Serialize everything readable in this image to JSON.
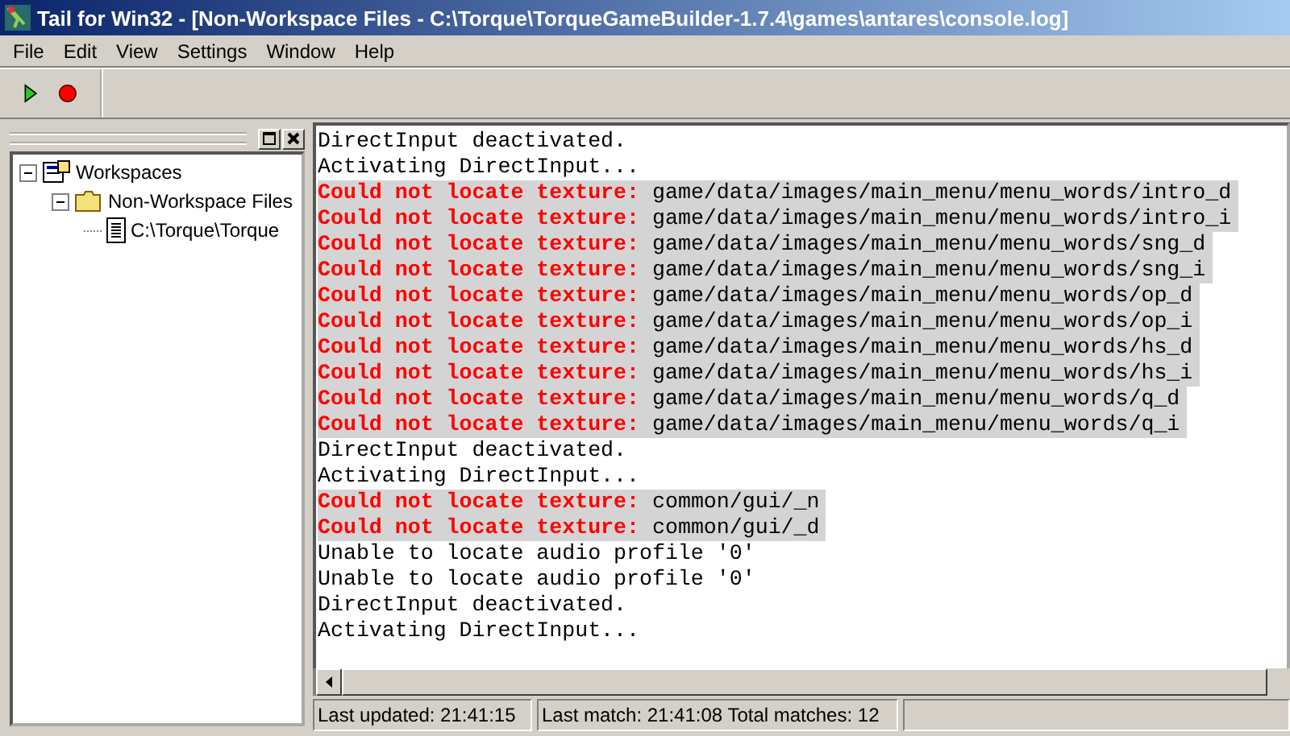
{
  "window": {
    "title": "Tail for Win32 - [Non-Workspace Files - C:\\Torque\\TorqueGameBuilder-1.7.4\\games\\antares\\console.log]"
  },
  "menu": [
    "File",
    "Edit",
    "View",
    "Settings",
    "Window",
    "Help"
  ],
  "toolbar": [
    {
      "kind": "play"
    },
    {
      "kind": "stop"
    }
  ],
  "tree": [
    {
      "label": "Workspaces",
      "kind": "workspace",
      "expanded": true,
      "children": [
        {
          "label": "Non-Workspace Files",
          "kind": "folder",
          "expanded": true,
          "children": [
            {
              "label": "C:\\Torque\\Torque",
              "kind": "file"
            }
          ]
        }
      ]
    }
  ],
  "log": [
    {
      "kind": "plain",
      "text": "DirectInput deactivated."
    },
    {
      "kind": "plain",
      "text": "Activating DirectInput..."
    },
    {
      "kind": "match",
      "match": "Could not locate texture:",
      "text": "game/data/images/main_menu/menu_words/intro_d"
    },
    {
      "kind": "match",
      "match": "Could not locate texture:",
      "text": "game/data/images/main_menu/menu_words/intro_i"
    },
    {
      "kind": "match",
      "match": "Could not locate texture:",
      "text": "game/data/images/main_menu/menu_words/sng_d"
    },
    {
      "kind": "match",
      "match": "Could not locate texture:",
      "text": "game/data/images/main_menu/menu_words/sng_i"
    },
    {
      "kind": "match",
      "match": "Could not locate texture:",
      "text": "game/data/images/main_menu/menu_words/op_d"
    },
    {
      "kind": "match",
      "match": "Could not locate texture:",
      "text": "game/data/images/main_menu/menu_words/op_i"
    },
    {
      "kind": "match",
      "match": "Could not locate texture:",
      "text": "game/data/images/main_menu/menu_words/hs_d"
    },
    {
      "kind": "match",
      "match": "Could not locate texture:",
      "text": "game/data/images/main_menu/menu_words/hs_i"
    },
    {
      "kind": "match",
      "match": "Could not locate texture:",
      "text": "game/data/images/main_menu/menu_words/q_d"
    },
    {
      "kind": "match",
      "match": "Could not locate texture:",
      "text": "game/data/images/main_menu/menu_words/q_i"
    },
    {
      "kind": "plain",
      "text": "DirectInput deactivated."
    },
    {
      "kind": "plain",
      "text": "Activating DirectInput..."
    },
    {
      "kind": "match",
      "match": "Could not locate texture:",
      "text": "common/gui/_n"
    },
    {
      "kind": "match",
      "match": "Could not locate texture:",
      "text": "common/gui/_d"
    },
    {
      "kind": "plain",
      "text": "Unable to locate audio profile '0'"
    },
    {
      "kind": "plain",
      "text": "Unable to locate audio profile '0'"
    },
    {
      "kind": "plain",
      "text": "DirectInput deactivated."
    },
    {
      "kind": "plain",
      "text": "Activating DirectInput..."
    }
  ],
  "status_bar": [
    "Last updated: 21:41:15",
    "Last match: 21:41:08 Total matches: 12"
  ]
}
